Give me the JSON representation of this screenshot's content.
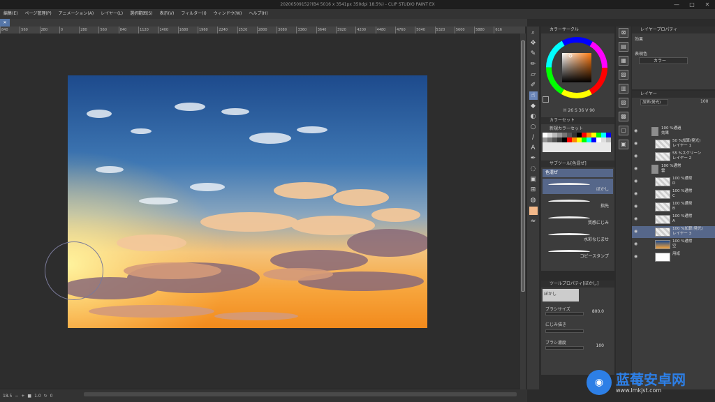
{
  "title": "20200509152?(B4 5016 x 3541px 350dpi 18.5%) - CLIP STUDIO PAINT EX",
  "window_controls": [
    "—",
    "□",
    "✕"
  ],
  "menu": [
    "編集(E)",
    "ページ管理(P)",
    "アニメーション(A)",
    "レイヤー(L)",
    "選択範囲(S)",
    "表示(V)",
    "フィルター(I)",
    "ウィンドウ(W)",
    "ヘルプ(H)"
  ],
  "tab_label": "✕",
  "ruler_labels": [
    "840",
    "560",
    "280",
    "0",
    "280",
    "560",
    "840",
    "1120",
    "1400",
    "1680",
    "1960",
    "2240",
    "2520",
    "2800",
    "3080",
    "3360",
    "3640",
    "3920",
    "4200",
    "4480",
    "4760",
    "5040",
    "5320",
    "5600",
    "5880",
    "616"
  ],
  "status": {
    "zoom": "18.5",
    "value": "1.0",
    "angle": "0"
  },
  "color_panel": {
    "title": "カラーサークル",
    "hsv": "H 26  S 36  V 90",
    "main_color": "#f4b98a"
  },
  "swatch_panel": {
    "title": "カラーセット",
    "set_name": "新規カラーセット"
  },
  "subtool_panel": {
    "title": "サブツール[色混ぜ]",
    "group": "色混ぜ",
    "brushes": [
      {
        "label": "ぼかし"
      },
      {
        "label": "指先"
      },
      {
        "label": "質感にじみ"
      },
      {
        "label": "水彩なじませ"
      },
      {
        "label": "コピースタンプ"
      }
    ]
  },
  "tool_props": {
    "title": "ツールプロパティ[ぼかし]",
    "tool_name": "ぼかし",
    "brush_size_label": "ブラシサイズ",
    "brush_size": "800.0",
    "blend_label": "にじみ描き",
    "density_label": "ブラシ濃度",
    "density": "100"
  },
  "property_panel": {
    "title": "レイヤープロパティ",
    "effect_label": "効果",
    "expression_label": "表現色",
    "expression_value": "カラー"
  },
  "layer_panel": {
    "title": "レイヤー",
    "blend_mode": "加算(発光)",
    "opacity": "100",
    "layers": [
      {
        "line1": "100 %通過",
        "line2": "効果",
        "folder": true
      },
      {
        "line1": "50 %加算(発光)",
        "line2": "レイヤー 1"
      },
      {
        "line1": "55 %スクリーン",
        "line2": "レイヤー 2"
      },
      {
        "line1": "100 %通常",
        "line2": "雲",
        "folder": true
      },
      {
        "line1": "100 %通常",
        "line2": "D"
      },
      {
        "line1": "100 %通常",
        "line2": "C"
      },
      {
        "line1": "100 %通常",
        "line2": "B"
      },
      {
        "line1": "100 %通常",
        "line2": "A"
      },
      {
        "line1": "100 %加算(発光)",
        "line2": "レイヤー 3",
        "selected": true
      },
      {
        "line1": "100 %通常",
        "line2": "空"
      },
      {
        "line1": "",
        "line2": "用紙"
      }
    ]
  },
  "watermark": {
    "text": "蓝莓安卓网",
    "url": "www.lmkjst.com"
  }
}
